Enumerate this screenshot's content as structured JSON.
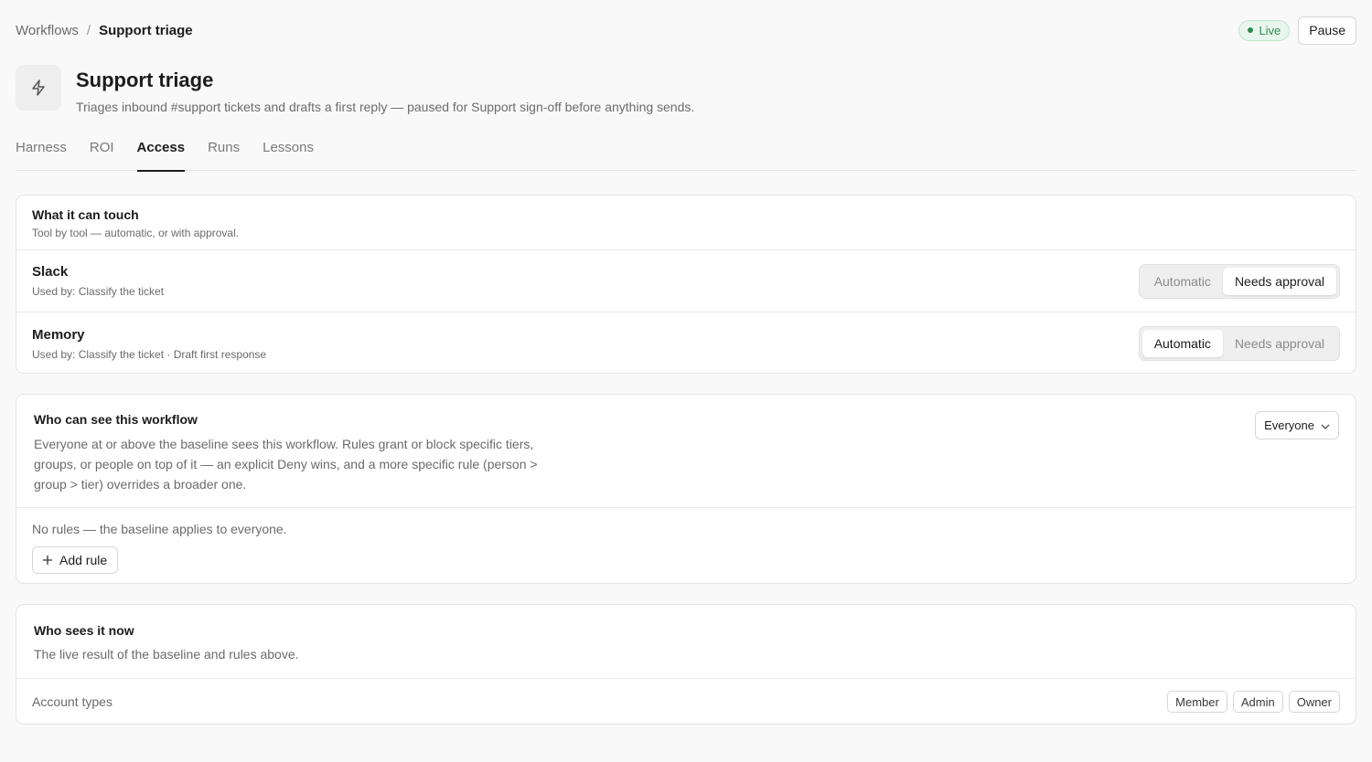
{
  "breadcrumb": {
    "parent": "Workflows",
    "separator": "/",
    "current": "Support triage"
  },
  "status": {
    "label": "Live",
    "color": "#2f8a52"
  },
  "actions": {
    "pause_label": "Pause"
  },
  "header": {
    "icon": "lightning-bolt-icon",
    "title": "Support triage",
    "description": "Triages inbound #support tickets and drafts a first reply — paused for Support sign-off before anything sends."
  },
  "tabs": [
    {
      "label": "Harness",
      "active": false
    },
    {
      "label": "ROI",
      "active": false
    },
    {
      "label": "Access",
      "active": true
    },
    {
      "label": "Runs",
      "active": false
    },
    {
      "label": "Lessons",
      "active": false
    }
  ],
  "touch": {
    "title": "What it can touch",
    "subtitle": "Tool by tool — automatic, or with approval.",
    "tools": [
      {
        "name": "Slack",
        "used_by": "Used by: Classify the ticket",
        "options": [
          "Automatic",
          "Needs approval"
        ],
        "selected": "Needs approval"
      },
      {
        "name": "Memory",
        "used_by": "Used by: Classify the ticket · Draft first response",
        "options": [
          "Automatic",
          "Needs approval"
        ],
        "selected": "Automatic"
      }
    ]
  },
  "visibility": {
    "title": "Who can see this workflow",
    "description": "Everyone at or above the baseline sees this workflow. Rules grant or block specific tiers, groups, or people on top of it — an explicit Deny wins, and a more specific rule (person > group > tier) overrides a broader one.",
    "baseline": "Everyone",
    "no_rules": "No rules — the baseline applies to everyone.",
    "add_rule_label": "Add rule"
  },
  "sees": {
    "title": "Who sees it now",
    "subtitle": "The live result of the baseline and rules above.",
    "account_types_label": "Account types",
    "account_types": [
      "Member",
      "Admin",
      "Owner"
    ]
  }
}
